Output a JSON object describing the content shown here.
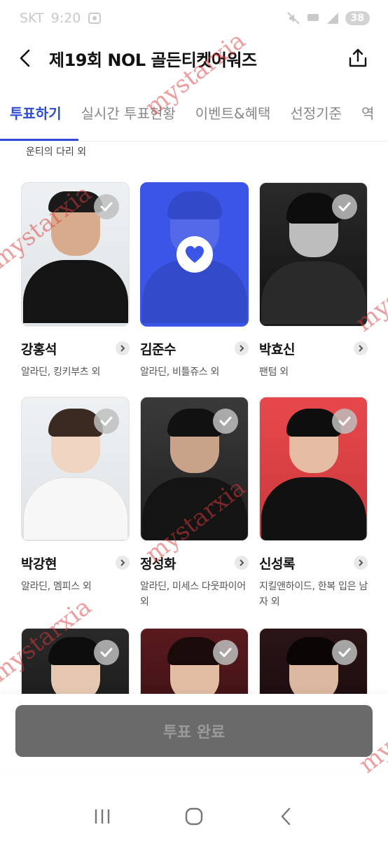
{
  "status_bar": {
    "carrier": "SKT",
    "time": "9:20",
    "battery": "38"
  },
  "header": {
    "title": "제19회 NOL 골든티켓어워즈"
  },
  "tabs": [
    {
      "label": "투표하기",
      "active": true
    },
    {
      "label": "실시간 투표현황",
      "active": false
    },
    {
      "label": "이벤트&혜택",
      "active": false
    },
    {
      "label": "선정기준",
      "active": false
    },
    {
      "label": "역",
      "active": false
    }
  ],
  "previous_row": {
    "subtitle": "운티의 다리 외"
  },
  "candidates": [
    {
      "name": "강홍석",
      "works": "알라딘, 킹키부츠 외",
      "selected": false
    },
    {
      "name": "김준수",
      "works": "알라딘, 비틀쥬스 외",
      "selected": true
    },
    {
      "name": "박효신",
      "works": "팬텀 외",
      "selected": false
    },
    {
      "name": "박강현",
      "works": "알라딘, 멤피스 외",
      "selected": false
    },
    {
      "name": "정성화",
      "works": "알라딘, 미세스 다웃파이어 외",
      "selected": false
    },
    {
      "name": "신성록",
      "works": "지킬앤하이드, 한복 입은 남자 외",
      "selected": false
    },
    {
      "name": "",
      "works": "",
      "selected": false
    },
    {
      "name": "",
      "works": "",
      "selected": false
    },
    {
      "name": "",
      "works": "",
      "selected": false
    }
  ],
  "vote_button": {
    "label": "투표 완료"
  },
  "watermark": {
    "text": "mystarxia"
  },
  "colors": {
    "accent": "#2d4bd6",
    "selected_card": "#3b55e6",
    "vote_button_bg": "#6a6a6a"
  },
  "icons": {
    "back": "chevron-left-icon",
    "share": "share-icon",
    "check": "check-icon",
    "heart": "heart-icon",
    "arrow": "chevron-right-icon",
    "nav_recent": "recent-apps-icon",
    "nav_home": "home-icon",
    "nav_back": "back-icon"
  }
}
